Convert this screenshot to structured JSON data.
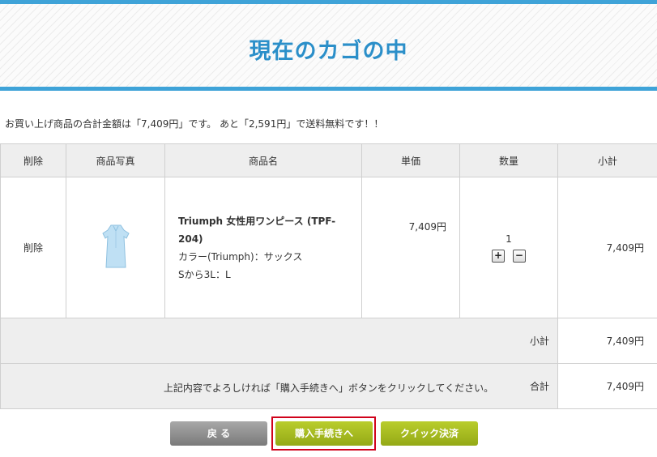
{
  "header": {
    "title": "現在のカゴの中"
  },
  "notice": "お買い上げ商品の合計金額は「7,409円」です。 あと「2,591円」で送料無料です！！",
  "table": {
    "headers": [
      "削除",
      "商品写真",
      "商品名",
      "単価",
      "数量",
      "小計"
    ],
    "items": [
      {
        "delete_label": "削除",
        "name": "Triumph 女性用ワンピース (TPF-204)",
        "option1": "カラー(Triumph)：サックス",
        "option2": "Sから3L：L",
        "price": "7,409円",
        "quantity": "1",
        "plus_label": "+",
        "minus_label": "−",
        "subtotal": "7,409円"
      }
    ],
    "subtotal_label": "小計",
    "subtotal_value": "7,409円",
    "total_label": "合計",
    "total_value": "7,409円"
  },
  "instruction": "上記内容でよろしければ「購入手続きへ」ボタンをクリックしてください。",
  "buttons": {
    "back": "戻 る",
    "purchase": "購入手続きへ",
    "quick": "クイック決済"
  },
  "colors": {
    "header_accent": "#3fa3d8",
    "title": "#2b8fc9",
    "button_green": "#a5ba1f",
    "button_gray": "#8e8e8e",
    "highlight": "#d0021b"
  },
  "icons": {
    "product_image": "dress-icon"
  }
}
